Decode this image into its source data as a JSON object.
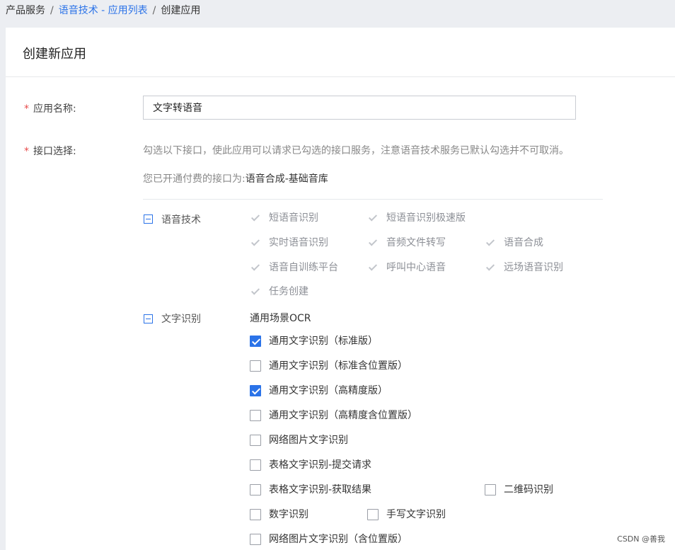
{
  "breadcrumb": {
    "home": "产品服务",
    "separator": "/",
    "parent": "语音技术 - 应用列表",
    "current": "创建应用"
  },
  "page_title": "创建新应用",
  "form": {
    "required_mark": "*",
    "name_label": "应用名称:",
    "name_value": "文字转语音",
    "api_label": "接口选择:",
    "hint": "勾选以下接口，使此应用可以请求已勾选的接口服务，注意语音技术服务已默认勾选并不可取消。",
    "paid_prefix": "您已开通付费的接口为:",
    "paid_value": "语音合成-基础音库"
  },
  "groups": {
    "speech": {
      "label": "语音技术",
      "options": [
        "短语音识别",
        "短语音识别极速版",
        "实时语音识别",
        "音频文件转写",
        "语音合成",
        "语音自训练平台",
        "呼叫中心语音",
        "远场语音识别",
        "任务创建"
      ]
    },
    "ocr": {
      "label": "文字识别",
      "subheading": "通用场景OCR",
      "options": [
        {
          "label": "通用文字识别（标准版）",
          "checked": true
        },
        {
          "label": "通用文字识别（标准含位置版）",
          "checked": false
        },
        {
          "label": "通用文字识别（高精度版）",
          "checked": true
        },
        {
          "label": "通用文字识别（高精度含位置版）",
          "checked": false
        },
        {
          "label": "网络图片文字识别",
          "checked": false
        },
        {
          "label": "表格文字识别-提交请求",
          "checked": false
        },
        {
          "label": "表格文字识别-获取结果",
          "checked": false
        },
        {
          "label": "二维码识别",
          "checked": false
        },
        {
          "label": "数字识别",
          "checked": false
        },
        {
          "label": "手写文字识别",
          "checked": false
        },
        {
          "label": "网络图片文字识别（含位置版）",
          "checked": false
        }
      ]
    }
  },
  "watermark": "CSDN @善我",
  "colors": {
    "accent": "#2b73e8",
    "required": "#e84b4b",
    "page_bg": "#eceef2"
  }
}
